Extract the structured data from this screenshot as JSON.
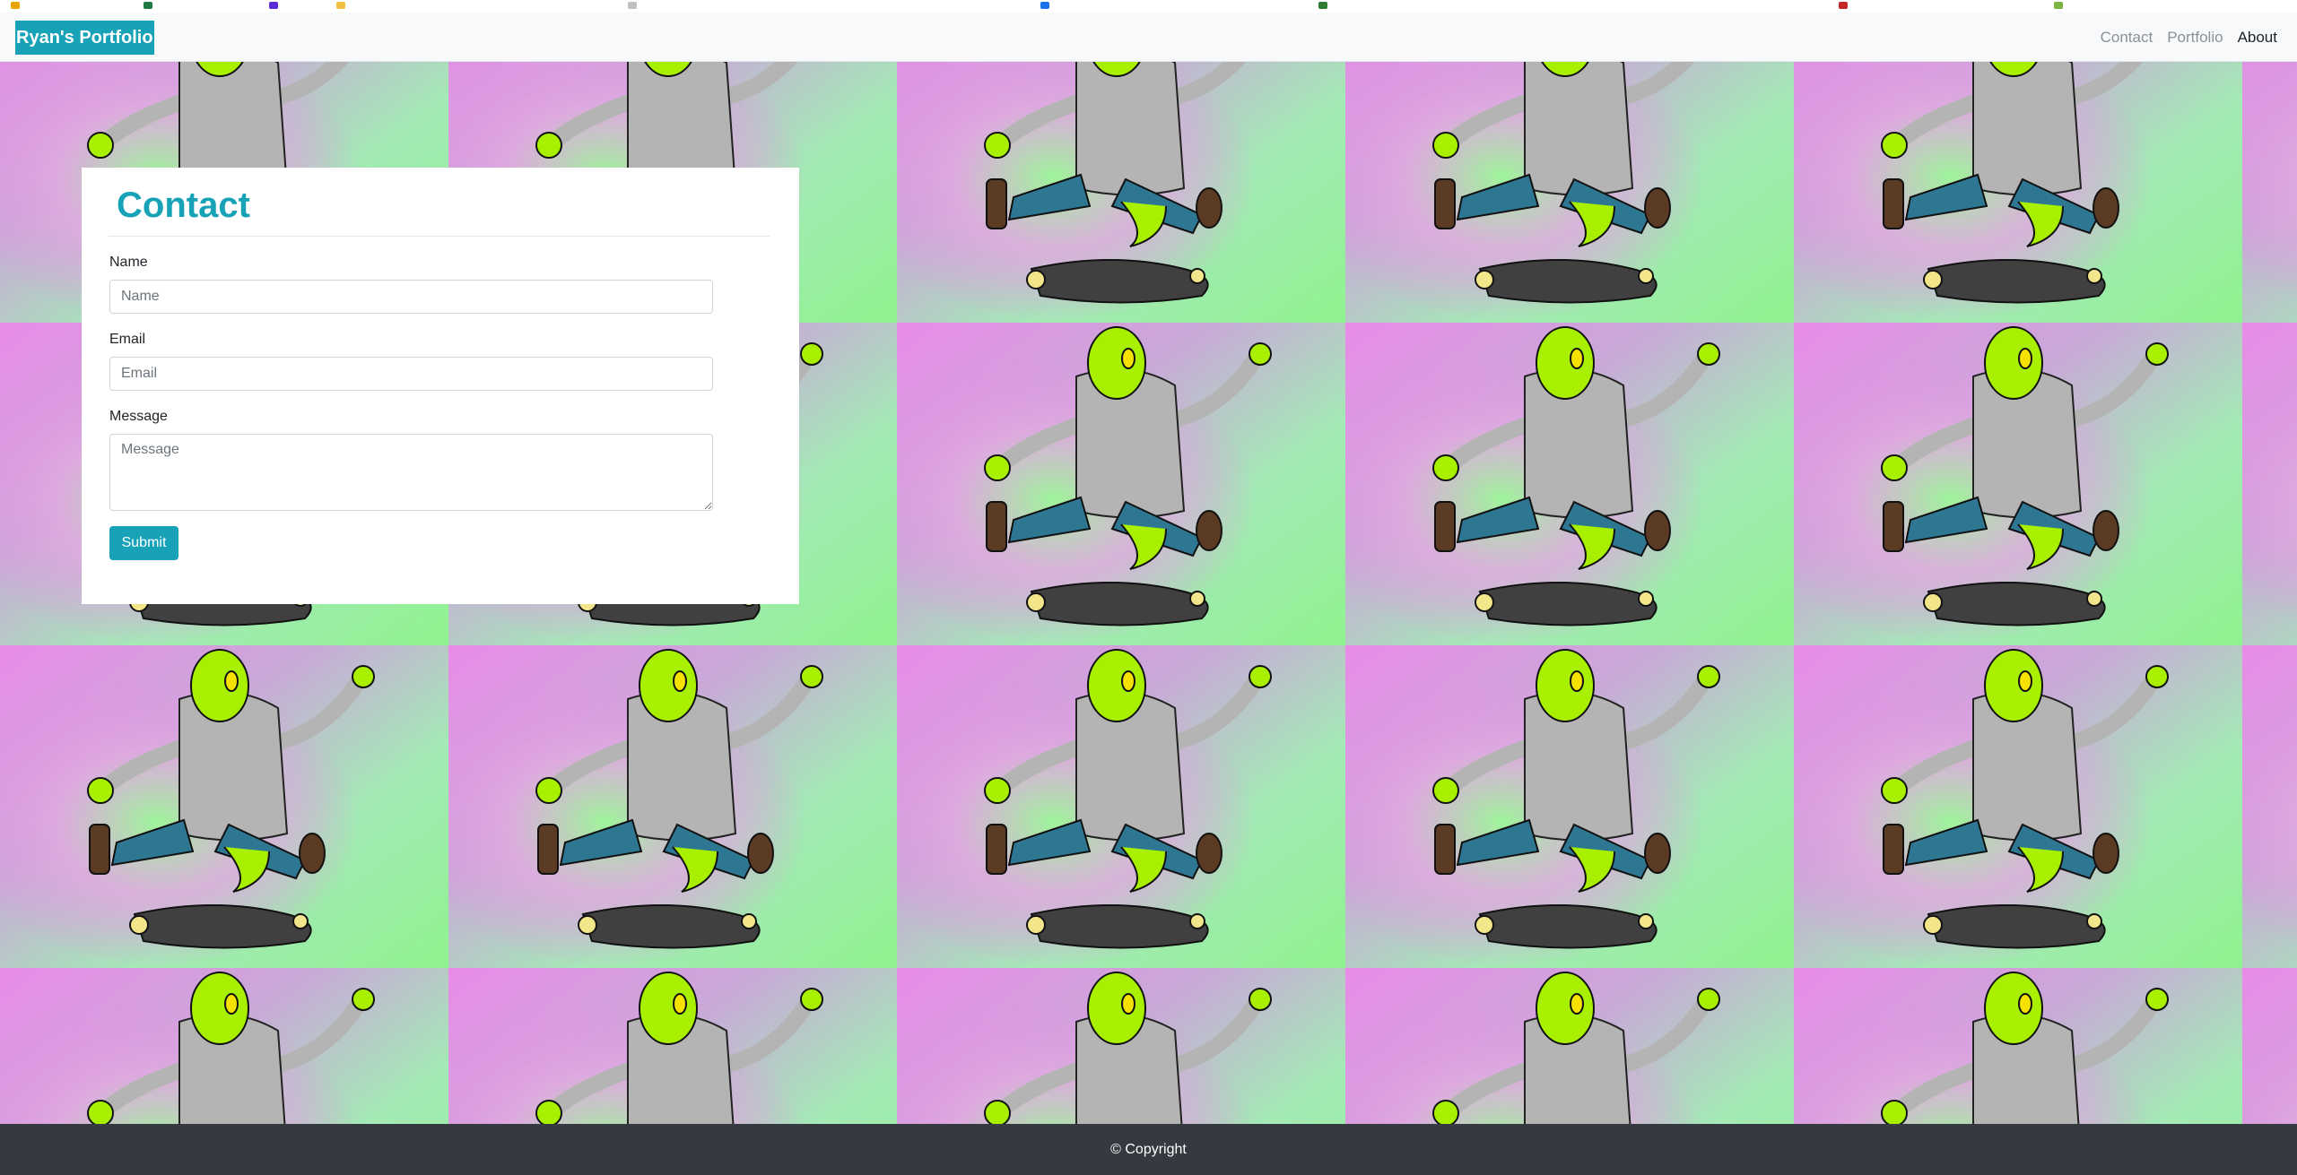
{
  "navbar": {
    "brand": "Ryan's Portfolio",
    "links": [
      {
        "label": "Contact"
      },
      {
        "label": "Portfolio"
      },
      {
        "label": "About",
        "active": true
      }
    ]
  },
  "background": {
    "tile_image": "repeating lizard-character-in-hoodie-icon",
    "colors": {
      "pink": "#e98ae6",
      "green": "#8ff38f",
      "lizard": "#a8f000",
      "hoodie": "#b4b4b4",
      "jeans": "#2e7793",
      "shoes": "#5b3b23",
      "snake": "#404040"
    }
  },
  "contact_form": {
    "title": "Contact",
    "fields": {
      "name": {
        "label": "Name",
        "placeholder": "Name",
        "value": ""
      },
      "email": {
        "label": "Email",
        "placeholder": "Email",
        "value": ""
      },
      "message": {
        "label": "Message",
        "placeholder": "Message",
        "value": ""
      }
    },
    "submit_label": "Submit"
  },
  "footer": {
    "text": "© Copyright"
  },
  "colors": {
    "accent": "#17a2b8",
    "navbar_bg": "#f8f9fa",
    "footer_bg": "#343a40"
  }
}
